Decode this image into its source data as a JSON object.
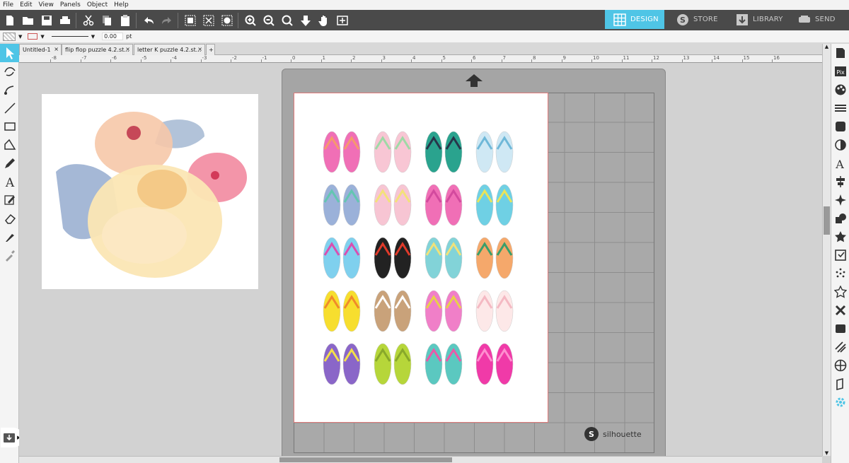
{
  "menu": [
    "File",
    "Edit",
    "View",
    "Panels",
    "Object",
    "Help"
  ],
  "nav": {
    "design": "DESIGN",
    "store": "STORE",
    "library": "LIBRARY",
    "send": "SEND"
  },
  "props": {
    "line_width": "0.00",
    "unit": "pt"
  },
  "doc_tabs": [
    "Untitled-1",
    "flip flop puzzle 4.2.st...",
    "letter K puzzle 4.2.st..."
  ],
  "new_tab": "+",
  "ruler_numbers": [
    "-8",
    "-7",
    "-6",
    "-5",
    "-4",
    "-3",
    "-2",
    "-1",
    "0",
    "1",
    "2",
    "3",
    "4",
    "5",
    "6",
    "7",
    "8",
    "9",
    "10",
    "11",
    "12",
    "13",
    "14",
    "15",
    "16"
  ],
  "brand": "silhouette",
  "colors": {
    "accent": "#4fc5e6",
    "toolbar_bg": "#4a4a4a",
    "mat": "#a5a5a5"
  },
  "sandals": [
    {
      "row": 1,
      "items": [
        {
          "c1": "#f06fb6",
          "c2": "#f59a6c"
        },
        {
          "c1": "#f8c6d4",
          "c2": "#9fd9a6"
        },
        {
          "c1": "#2aa38e",
          "c2": "#27364a"
        },
        {
          "c1": "#cfe8f4",
          "c2": "#6fb8d8"
        }
      ]
    },
    {
      "row": 2,
      "items": [
        {
          "c1": "#9bb1d9",
          "c2": "#64c6b2"
        },
        {
          "c1": "#f7c5d3",
          "c2": "#f3e17a"
        },
        {
          "c1": "#f06fb6",
          "c2": "#d34a9e"
        },
        {
          "c1": "#6fd0e4",
          "c2": "#e8e45a"
        }
      ]
    },
    {
      "row": 3,
      "items": [
        {
          "c1": "#7fd0ee",
          "c2": "#d94fb0"
        },
        {
          "c1": "#222222",
          "c2": "#e03a2a"
        },
        {
          "c1": "#82d3d8",
          "c2": "#f0e27a"
        },
        {
          "c1": "#f5a86b",
          "c2": "#3a9e6a"
        }
      ]
    },
    {
      "row": 4,
      "items": [
        {
          "c1": "#f7de2e",
          "c2": "#f08a2a"
        },
        {
          "c1": "#c9a27a",
          "c2": "#ffffff"
        },
        {
          "c1": "#f07fc8",
          "c2": "#e8d04a"
        },
        {
          "c1": "#fde8e8",
          "c2": "#f4b9c3"
        }
      ]
    },
    {
      "row": 5,
      "items": [
        {
          "c1": "#8a66c8",
          "c2": "#f4e04a"
        },
        {
          "c1": "#b6d63a",
          "c2": "#88a82a"
        },
        {
          "c1": "#5bc8c0",
          "c2": "#e85aa8"
        },
        {
          "c1": "#f03aa8",
          "c2": "#ff8fd0"
        }
      ]
    }
  ]
}
